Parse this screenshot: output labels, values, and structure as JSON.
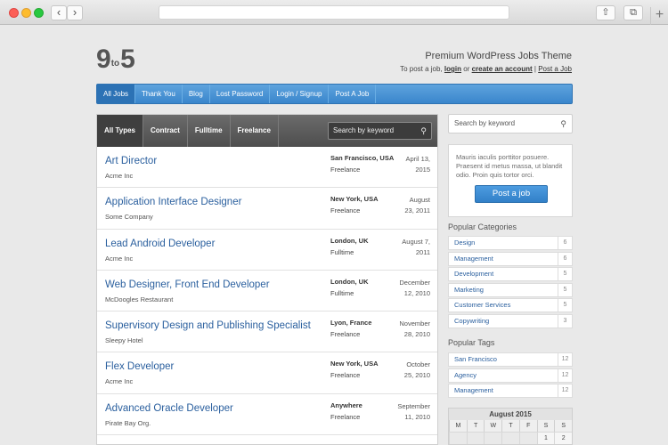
{
  "browser": {
    "back": "‹",
    "forward": "›",
    "share": "⇧",
    "tabs": "⧉",
    "new_tab": "+"
  },
  "header": {
    "logo_left": "9",
    "logo_mid": "to",
    "logo_right": "5",
    "tagline": "Premium WordPress Jobs Theme",
    "post_prefix": "To post a job,",
    "login": "login",
    "or": "or",
    "create_account": "create an account",
    "separator": "|",
    "post_a_job": "Post a Job"
  },
  "nav": [
    "All Jobs",
    "Thank You",
    "Blog",
    "Lost Password",
    "Login / Signup",
    "Post A Job"
  ],
  "filters": {
    "types": [
      "All Types",
      "Contract",
      "Fulltime",
      "Freelance"
    ],
    "keyword_placeholder": "Search by keyword"
  },
  "jobs": [
    {
      "title": "Art Director",
      "company": "Acme Inc",
      "location": "San Francisco, USA",
      "type": "Freelance",
      "date_line1": "April 13,",
      "date_line2": "2015"
    },
    {
      "title": "Application Interface Designer",
      "company": "Some Company",
      "location": "New York, USA",
      "type": "Freelance",
      "date_line1": "August",
      "date_line2": "23, 2011"
    },
    {
      "title": "Lead Android Developer",
      "company": "Acme Inc",
      "location": "London, UK",
      "type": "Fulltime",
      "date_line1": "August 7,",
      "date_line2": "2011"
    },
    {
      "title": "Web Designer, Front End Developer",
      "company": "McDoogles Restaurant",
      "location": "London, UK",
      "type": "Fulltime",
      "date_line1": "December",
      "date_line2": "12, 2010"
    },
    {
      "title": "Supervisory Design and Publishing Specialist",
      "company": "Sleepy Hotel",
      "location": "Lyon, France",
      "type": "Freelance",
      "date_line1": "November",
      "date_line2": "28, 2010"
    },
    {
      "title": "Flex Developer",
      "company": "Acme Inc",
      "location": "New York, USA",
      "type": "Freelance",
      "date_line1": "October",
      "date_line2": "25, 2010"
    },
    {
      "title": "Advanced Oracle Developer",
      "company": "Pirate Bay Org.",
      "location": "Anywhere",
      "type": "Freelance",
      "date_line1": "September",
      "date_line2": "11, 2010"
    }
  ],
  "sidebar": {
    "search_placeholder": "Search by keyword",
    "promo_text": "Mauris iaculis porttitor posuere. Praesent id metus massa, ut blandit odio. Proin quis tortor orci.",
    "promo_button": "Post a job",
    "categories_heading": "Popular Categories",
    "categories": [
      {
        "name": "Design",
        "count": "6"
      },
      {
        "name": "Management",
        "count": "6"
      },
      {
        "name": "Development",
        "count": "5"
      },
      {
        "name": "Marketing",
        "count": "5"
      },
      {
        "name": "Customer Services",
        "count": "5"
      },
      {
        "name": "Copywriting",
        "count": "3"
      }
    ],
    "tags_heading": "Popular Tags",
    "tags": [
      {
        "name": "San Francisco",
        "count": "12"
      },
      {
        "name": "Agency",
        "count": "12"
      },
      {
        "name": "Management",
        "count": "12"
      }
    ],
    "calendar": {
      "month": "August 2015",
      "days": [
        "M",
        "T",
        "W",
        "T",
        "F",
        "S",
        "S"
      ],
      "first_row": [
        "",
        "",
        "",
        "",
        "",
        "1",
        "2"
      ]
    }
  },
  "icons": {
    "search": "search-icon"
  }
}
